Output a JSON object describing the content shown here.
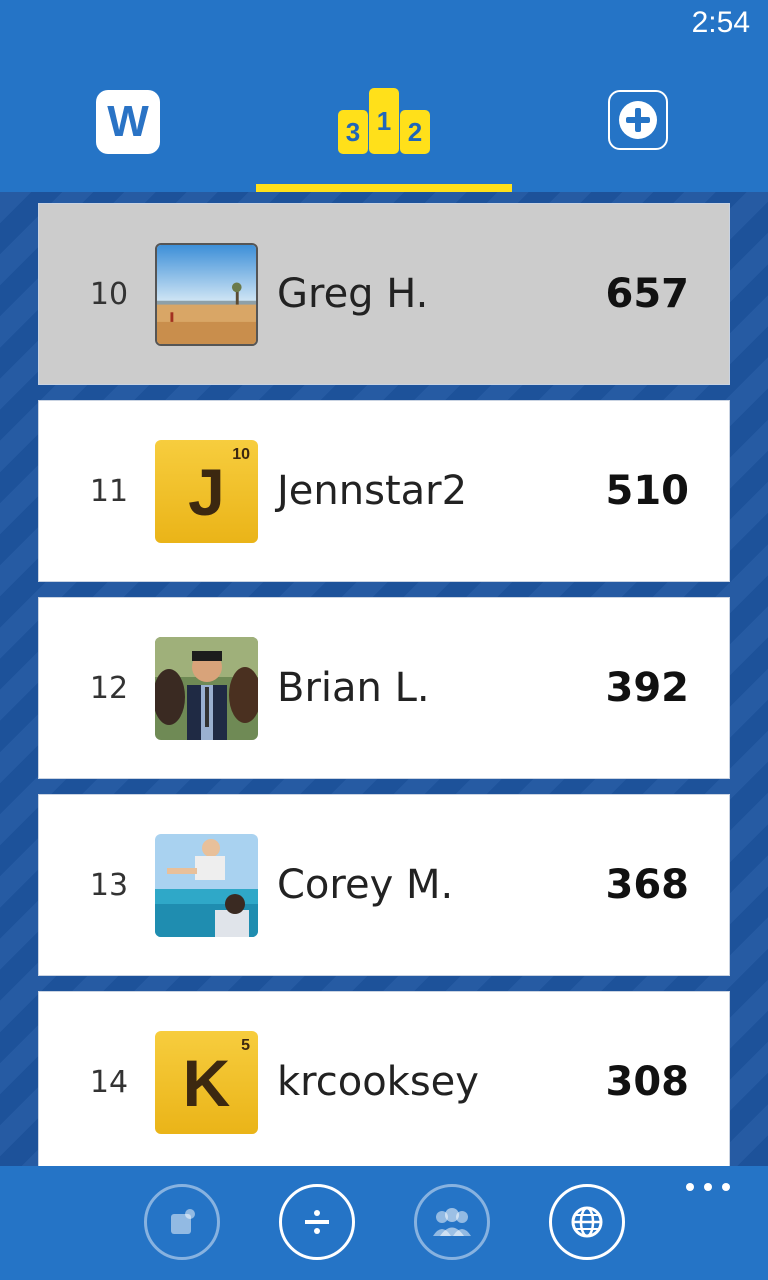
{
  "status_bar": {
    "time": "2:54"
  },
  "header": {
    "logo_letter": "W",
    "podium": [
      "3",
      "1",
      "2"
    ],
    "accent": "#ffe01a"
  },
  "leaderboard": [
    {
      "rank": "10",
      "name": "Greg H.",
      "score": "657",
      "avatar": "photo-landscape",
      "highlight": true
    },
    {
      "rank": "11",
      "name": "Jennstar2",
      "score": "510",
      "avatar": "tile",
      "tile_letter": "J",
      "tile_points": "10"
    },
    {
      "rank": "12",
      "name": "Brian L.",
      "score": "392",
      "avatar": "photo-portrait"
    },
    {
      "rank": "13",
      "name": "Corey M.",
      "score": "368",
      "avatar": "photo-beach"
    },
    {
      "rank": "14",
      "name": "krcooksey",
      "score": "308",
      "avatar": "tile",
      "tile_letter": "K",
      "tile_points": "5"
    }
  ],
  "app_bar": {
    "buttons": [
      "new-note-icon",
      "divide-icon",
      "people-icon",
      "globe-icon"
    ],
    "more": "more-icon"
  },
  "colors": {
    "header_bg": "#2574c6",
    "list_bg": "#1e55a0",
    "highlight_row": "#cccccc",
    "tile": "#f0c02a"
  }
}
